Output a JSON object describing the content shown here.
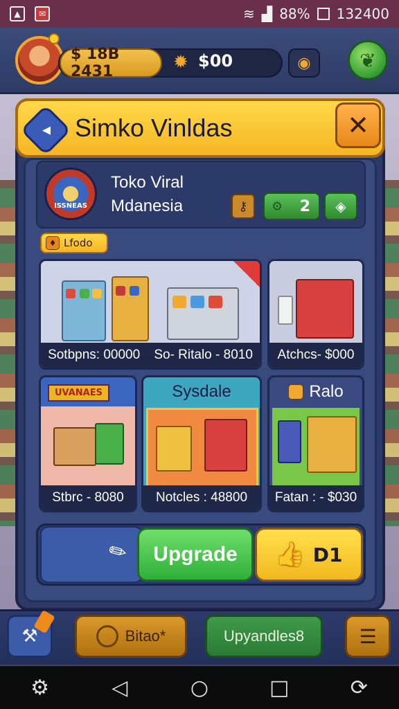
{
  "status_bar": {
    "battery": "88%",
    "time": "132400"
  },
  "hud": {
    "coins": "$ 18B 2431",
    "gems": "$00",
    "colors": {
      "coin": "#f2c14e",
      "leaf": "#3fa83a"
    }
  },
  "dialog": {
    "title": "Simko Vinldas",
    "store_name_line1": "Toko Viral",
    "store_name_line2": "Mdanesia",
    "staff_count": "2",
    "tag_label": "Lfodo",
    "store_logo_text": "ISSNEAS"
  },
  "items": [
    {
      "caption": "Sotbpns: 00000",
      "caption2": "So- Ritalo - 8010"
    },
    {
      "caption": "Atchcs- $000"
    },
    {
      "caption": "Stbrc - 8080",
      "banner": "UVANAES"
    },
    {
      "header": "Sysdale",
      "caption": "Notcles : 48800"
    },
    {
      "header": "Ralo",
      "caption": "Fatan : - $030"
    }
  ],
  "actions": {
    "upgrade_label": "Upgrade",
    "like_label": "D1"
  },
  "bottom_bar": {
    "bitao_label": "Bitao*",
    "upyandles_label": "Upyandles8"
  }
}
